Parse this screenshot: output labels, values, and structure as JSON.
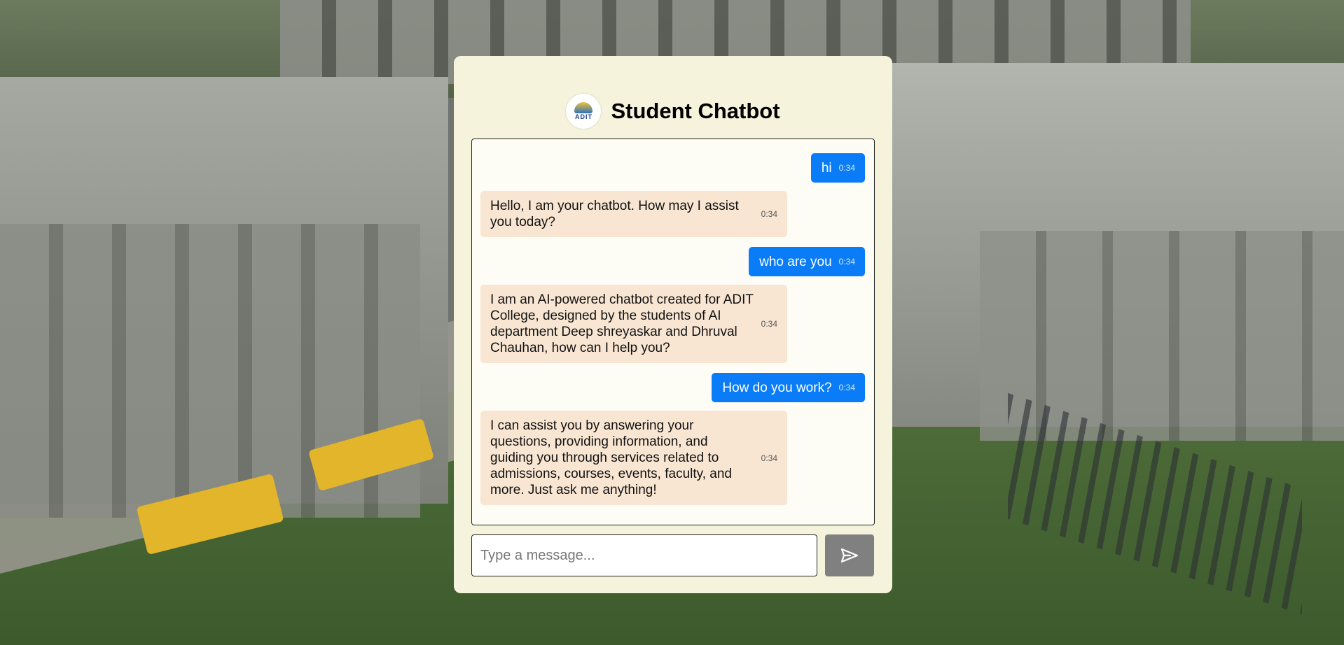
{
  "app": {
    "title": "Student Chatbot",
    "logo_text": "ADIT"
  },
  "messages": [
    {
      "sender": "user",
      "text": "hi",
      "time": "0:34"
    },
    {
      "sender": "bot",
      "text": "Hello, I am your chatbot. How may I assist you today?",
      "time": "0:34"
    },
    {
      "sender": "user",
      "text": "who are you",
      "time": "0:34"
    },
    {
      "sender": "bot",
      "text": "I am an AI-powered chatbot created for ADIT College, designed by the students of AI department Deep shreyaskar and Dhruval Chauhan, how can I help you?",
      "time": "0:34"
    },
    {
      "sender": "user",
      "text": "How do you work?",
      "time": "0:34"
    },
    {
      "sender": "bot",
      "text": "I can assist you by answering your questions, providing information, and guiding you through services related to admissions, courses, events, faculty, and more. Just ask me anything!",
      "time": "0:34"
    }
  ],
  "input": {
    "placeholder": "Type a message...",
    "value": ""
  },
  "send_button": {
    "icon": "send-icon"
  },
  "colors": {
    "card_bg": "#f5f3dc",
    "user_bubble": "#0a7cf8",
    "bot_bubble": "#f8e6d3",
    "send_button": "#808080"
  }
}
